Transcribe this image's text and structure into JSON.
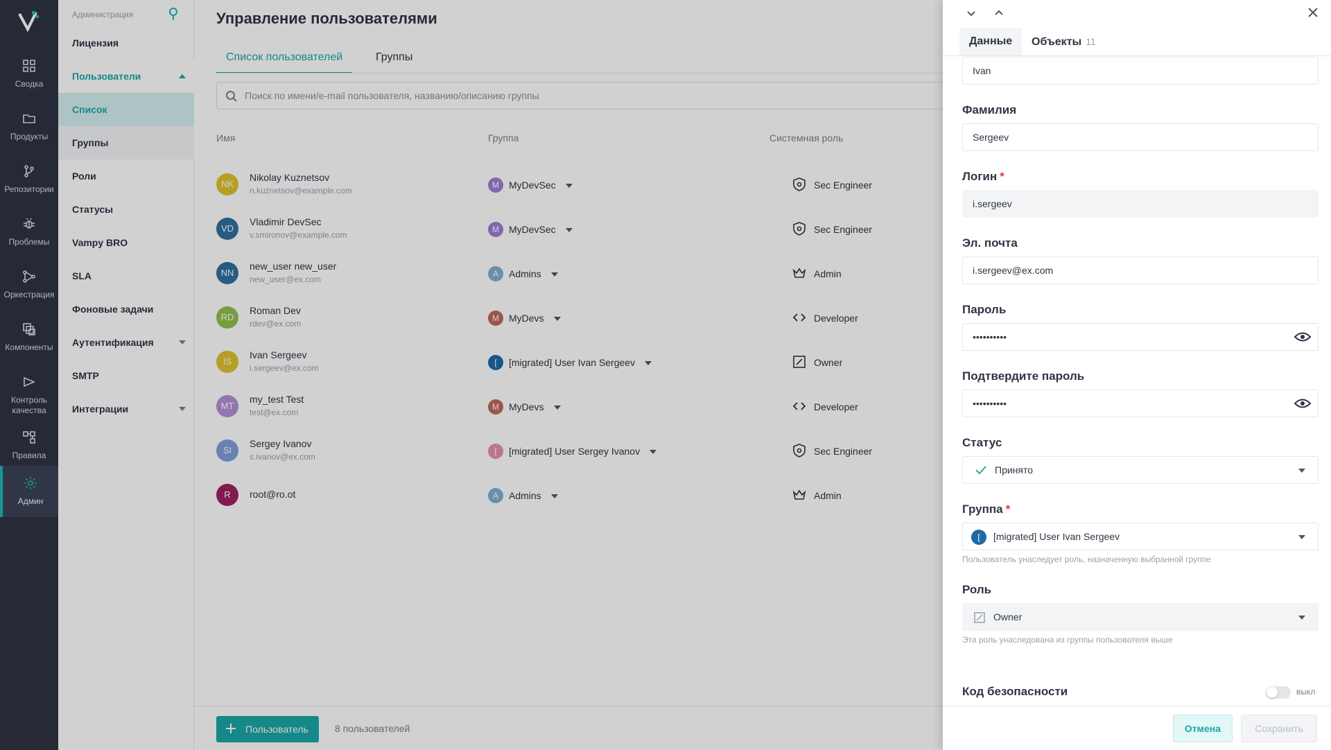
{
  "rail": {
    "items": [
      {
        "label": "Сводка",
        "icon": "dashboard-icon"
      },
      {
        "label": "Продукты",
        "icon": "folder-icon"
      },
      {
        "label": "Репозитории",
        "icon": "branch-icon"
      },
      {
        "label": "Проблемы",
        "icon": "bug-icon"
      },
      {
        "label": "Оркестрация",
        "icon": "orchestration-icon"
      },
      {
        "label": "Компоненты",
        "icon": "components-icon"
      },
      {
        "label": "Контроль качества",
        "icon": "quality-gate-icon"
      },
      {
        "label": "Правила",
        "icon": "rules-icon"
      },
      {
        "label": "Админ",
        "icon": "gear-icon"
      }
    ]
  },
  "subnav": {
    "header": "Администрация",
    "items": [
      "Лицензия",
      "Пользователи",
      "Список",
      "Группы",
      "Роли",
      "Статусы",
      "Vampy BRO",
      "SLA",
      "Фоновые задачи",
      "Аутентификация",
      "SMTP",
      "Интеграции"
    ]
  },
  "main": {
    "title": "Управление пользователями",
    "tabs": [
      "Список пользователей",
      "Группы"
    ],
    "search_placeholder": "Поиск по имени/e-mail пользователя, названию/описанию группы",
    "columns": [
      "Имя",
      "Группа",
      "Системная роль"
    ],
    "users": [
      {
        "initials": "NK",
        "name": "Nikolay Kuznetsov",
        "email": "n.kuznetsov@example.com",
        "group_initial": "M",
        "group": "MyDevSec",
        "role": "Sec Engineer",
        "avatar_color": "#e0c12e",
        "group_color": "#9b7fd4"
      },
      {
        "initials": "VD",
        "name": "Vladimir DevSec",
        "email": "v.smironov@example.com",
        "group_initial": "M",
        "group": "MyDevSec",
        "role": "Sec Engineer",
        "avatar_color": "#2f6f9f",
        "group_color": "#9b7fd4"
      },
      {
        "initials": "NN",
        "name": "new_user new_user",
        "email": "new_user@ex.com",
        "group_initial": "A",
        "group": "Admins",
        "role": "Admin",
        "avatar_color": "#2f6f9f",
        "group_color": "#7fb0d4"
      },
      {
        "initials": "RD",
        "name": "Roman Dev",
        "email": "rdev@ex.com",
        "group_initial": "M",
        "group": "MyDevs",
        "role": "Developer",
        "avatar_color": "#8fbf4f",
        "group_color": "#c0685a"
      },
      {
        "initials": "IS",
        "name": "Ivan Sergeev",
        "email": "i.sergeev@ex.com",
        "group_initial": "[",
        "group": "[migrated] User Ivan Sergeev",
        "role": "Owner",
        "avatar_color": "#e0c12e",
        "group_color": "#1f6aa5"
      },
      {
        "initials": "MT",
        "name": "my_test Test",
        "email": "test@ex.com",
        "group_initial": "M",
        "group": "MyDevs",
        "role": "Developer",
        "avatar_color": "#b48fd8",
        "group_color": "#c0685a"
      },
      {
        "initials": "SI",
        "name": "Sergey Ivanov",
        "email": "s.ivanov@ex.com",
        "group_initial": "[",
        "group": "[migrated] User Sergey Ivanov",
        "role": "Sec Engineer",
        "avatar_color": "#7f9fd8",
        "group_color": "#e48fb4"
      },
      {
        "initials": "R",
        "name": "root@ro.ot",
        "email": "",
        "group_initial": "A",
        "group": "Admins",
        "role": "Admin",
        "avatar_color": "#a0205f",
        "group_color": "#7fb0d4"
      }
    ],
    "add_button": "Пользователь",
    "count_text": "8 пользователей"
  },
  "drawer": {
    "tabs": {
      "data": "Данные",
      "objects": "Объекты",
      "objects_count": "11"
    },
    "first_name_value": "Ivan",
    "last_name_label": "Фамилия",
    "last_name_value": "Sergeev",
    "login_label": "Логин",
    "login_value": "i.sergeev",
    "email_label": "Эл. почта",
    "email_value": "i.sergeev@ex.com",
    "password_label": "Пароль",
    "password_value": "••••••••••",
    "confirm_label": "Подтвердите пароль",
    "confirm_value": "••••••••••",
    "status_label": "Статус",
    "status_value": "Принято",
    "group_label": "Группа",
    "group_initial": "[",
    "group_value": "[migrated] User Ivan Sergeev",
    "group_hint": "Пользователь унаследует роль, назначенную выбранной группе",
    "role_label": "Роль",
    "role_value": "Owner",
    "role_hint": "Эта роль унаследована из группы пользователя выше",
    "security_label": "Код безопасности",
    "security_toggle": "выкл",
    "cancel": "Отмена",
    "save": "Сохранить"
  },
  "colors": {
    "accent": "#1ba7a7",
    "rail_bg": "#2f3444",
    "required": "#e53935"
  }
}
